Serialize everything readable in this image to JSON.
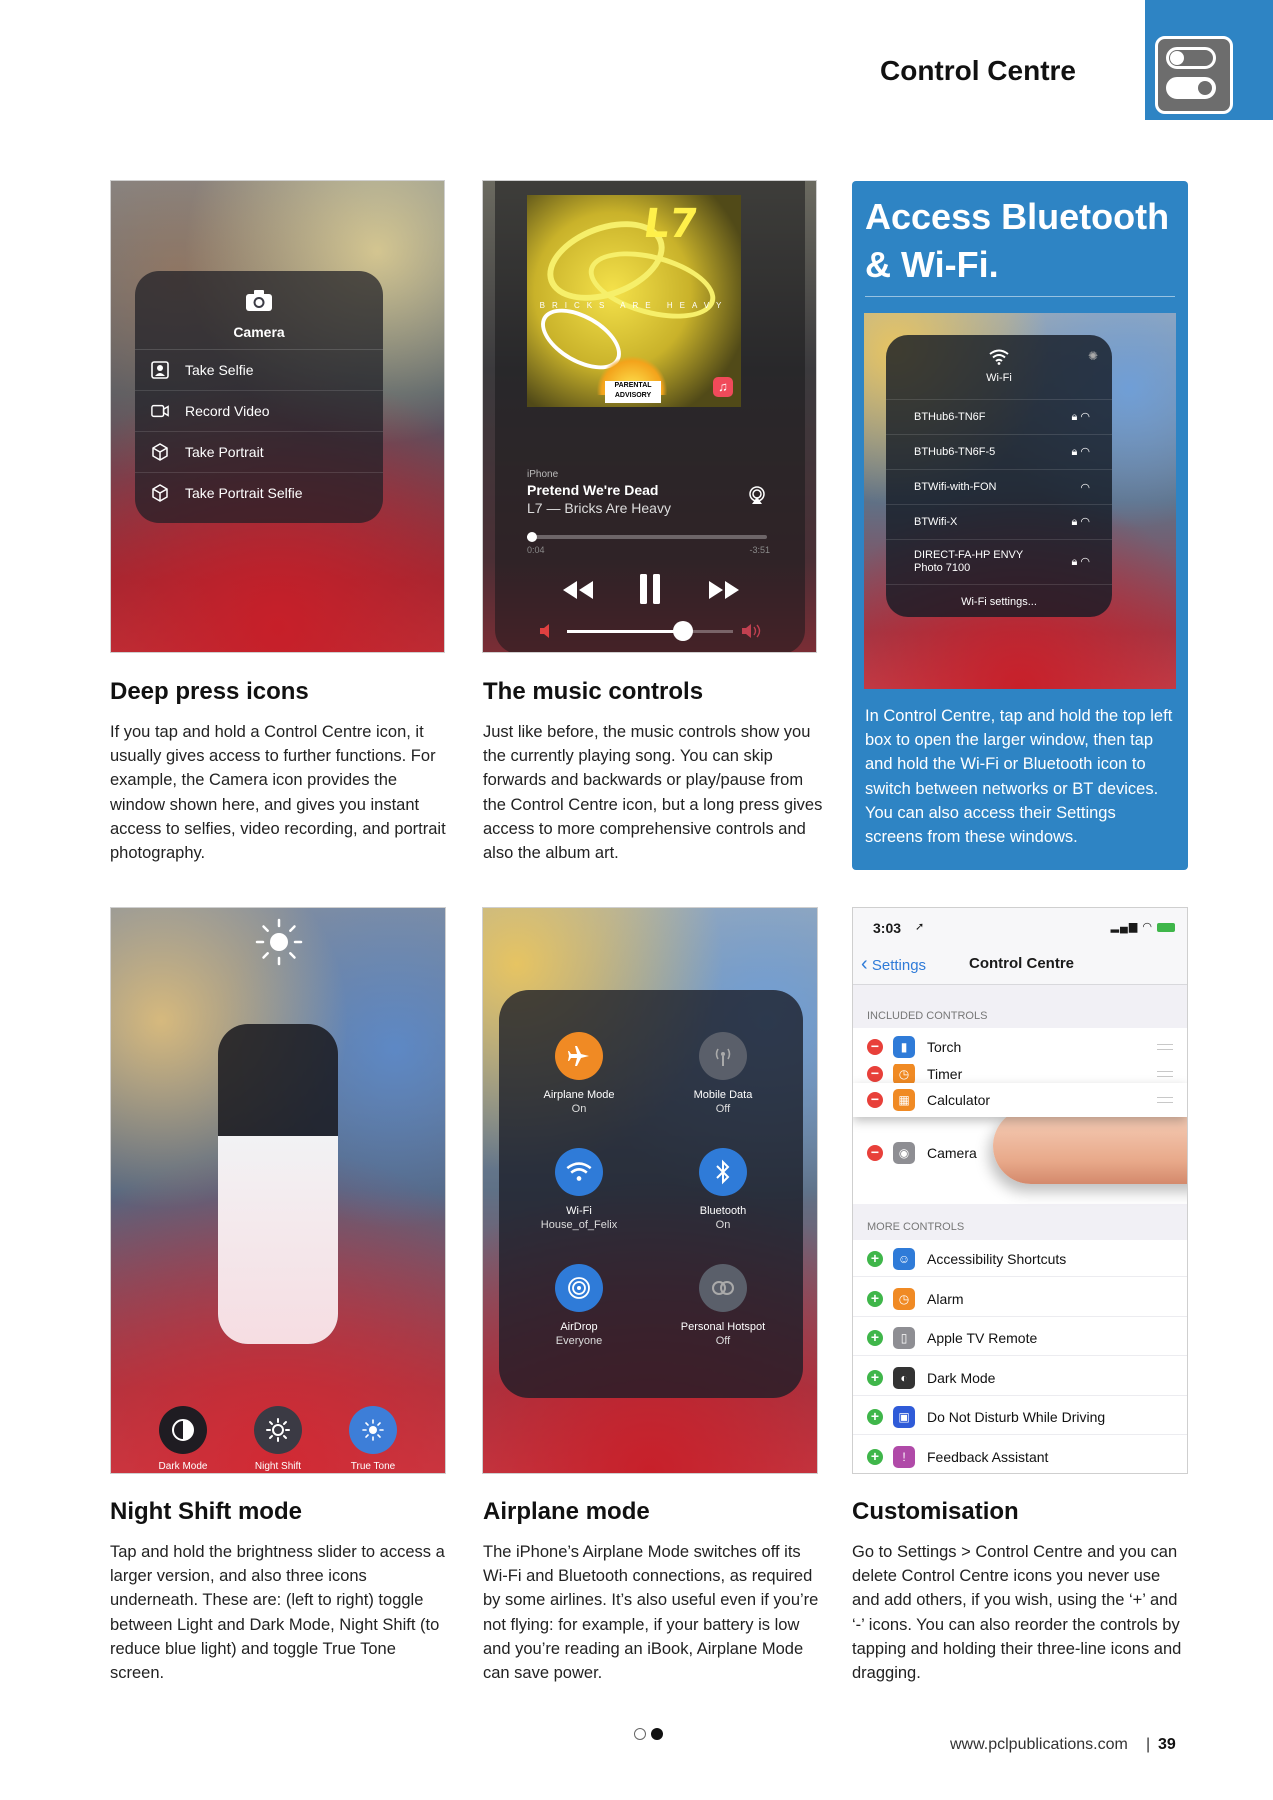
{
  "header": {
    "title": "Control Centre"
  },
  "camera_panel": {
    "title": "Camera",
    "items": [
      "Take Selfie",
      "Record Video",
      "Take Portrait",
      "Take Portrait Selfie"
    ]
  },
  "music_panel": {
    "album_band": "L7",
    "album_title_art": "BRICKS ARE HEAVY",
    "source": "iPhone",
    "song": "Pretend We're Dead",
    "artist_album": "L7 — Bricks Are Heavy",
    "elapsed": "0:04",
    "remaining": "-3:51",
    "progress": 0.02,
    "volume": 0.7
  },
  "bluetooth_box": {
    "title_line1": "Access Bluetooth",
    "title_line2": "& Wi-Fi.",
    "wifi_label": "Wi-Fi",
    "networks": [
      "BTHub6-TN6F",
      "BTHub6-TN6F-5",
      "BTWifi-with-FON",
      "BTWifi-X",
      "DIRECT-FA-HP ENVY Photo 7100"
    ],
    "settings_link": "Wi-Fi settings...",
    "body": "In Control Centre, tap and hold the top left box to open the larger window, then tap and hold the Wi-Fi or Bluetooth icon to switch between networks or BT devices. You can also access their Settings screens from these windows."
  },
  "sections": {
    "deep_press": {
      "title": "Deep press icons",
      "body": "If you tap and hold a Control Centre icon, it usually gives access to further functions. For example, the Camera icon provides the window shown here, and gives you instant access to selfies, video recording, and portrait photography."
    },
    "music": {
      "title": "The music controls",
      "body": "Just like before, the music controls show you the currently playing song. You can skip forwards and backwards or play/pause from the Control Centre icon, but a long press gives access to more comprehensive controls and also the album art."
    },
    "night_shift": {
      "title": "Night Shift mode",
      "body": "Tap and hold the brightness slider to access a larger version, and also three icons underneath. These are: (left to right) toggle between Light and Dark Mode, Night Shift (to reduce blue light) and toggle True Tone screen."
    },
    "airplane": {
      "title": "Airplane mode",
      "body": "The iPhone’s Airplane Mode switches off its Wi-Fi and Bluetooth connections, as required by some airlines. It’s also useful even if you’re not flying: for example, if your battery is low and you’re reading an iBook, Airplane Mode can save power."
    },
    "customisation": {
      "title": "Customisation",
      "body": "Go to Settings > Control Centre and you can delete Control Centre icons you never use and add others, if you wish, using the ‘+’ and ‘-’ icons. You can also reorder the controls by tapping and holding their three-line icons and dragging."
    }
  },
  "brightness_panel": {
    "level": 0.65,
    "buttons": [
      "Dark Mode",
      "Night Shift",
      "True Tone"
    ]
  },
  "connectivity_panel": {
    "tiles": [
      {
        "name": "Airplane Mode",
        "state": "On",
        "color": "#f08a24"
      },
      {
        "name": "Mobile Data",
        "state": "Off",
        "color": "#5a5f6a"
      },
      {
        "name": "Wi-Fi",
        "state": "House_of_Felix",
        "color": "#2f7bd8"
      },
      {
        "name": "Bluetooth",
        "state": "On",
        "color": "#2f7bd8"
      },
      {
        "name": "AirDrop",
        "state": "Everyone",
        "color": "#2f7bd8"
      },
      {
        "name": "Personal Hotspot",
        "state": "Off",
        "color": "#5a5f6a"
      }
    ]
  },
  "settings_screen": {
    "time": "3:03",
    "back": "Settings",
    "title": "Control Centre",
    "included_header": "INCLUDED CONTROLS",
    "included": [
      "Torch",
      "Timer",
      "Calculator",
      "Camera"
    ],
    "more_header": "MORE CONTROLS",
    "more": [
      "Accessibility Shortcuts",
      "Alarm",
      "Apple TV Remote",
      "Dark Mode",
      "Do Not Disturb While Driving",
      "Feedback Assistant"
    ]
  },
  "footer": {
    "url": "www.pclpublications.com",
    "separator": "|",
    "page": "39"
  },
  "colors": {
    "accent_blue": "#2e84c4"
  }
}
